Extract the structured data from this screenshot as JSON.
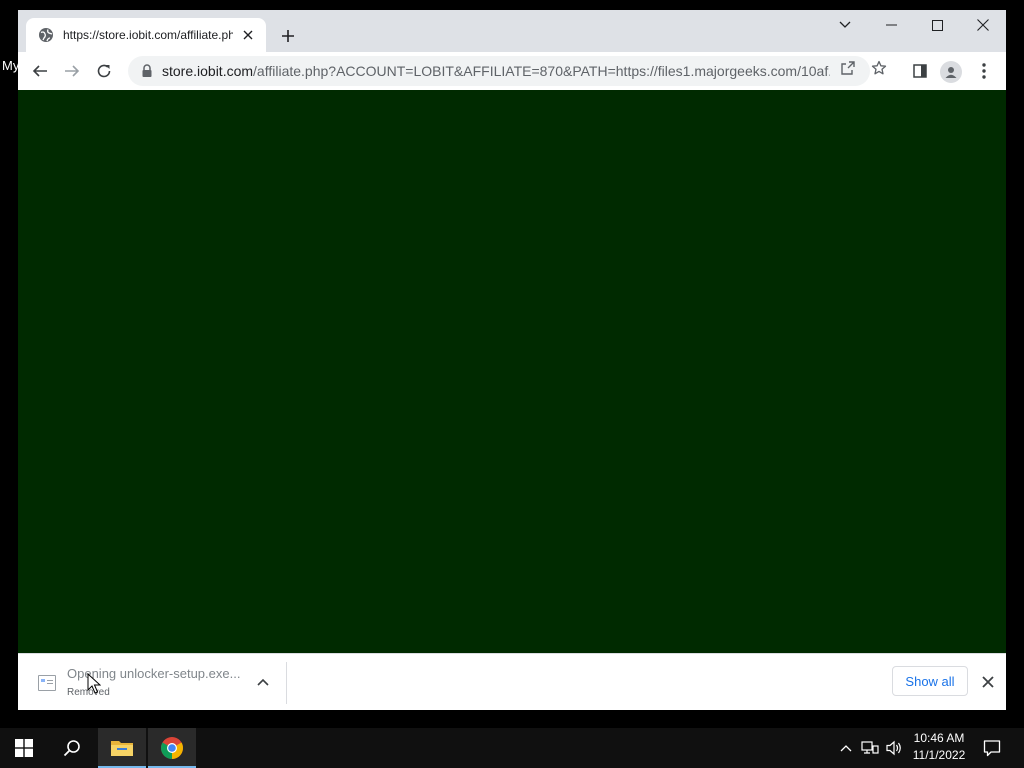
{
  "desktop": {
    "label": "My"
  },
  "browser": {
    "tab": {
      "title": "https://store.iobit.com/affiliate.php"
    },
    "url": {
      "host": "store.iobit.com",
      "path": "/affiliate.php?ACCOUNT=LOBIT&AFFILIATE=870&PATH=https://files1.majorgeeks.com/10af..."
    }
  },
  "page": {
    "background_color": "#002a00"
  },
  "download_shelf": {
    "item": {
      "name": "Opening unlocker-setup.exe...",
      "status": "Removed"
    },
    "show_all_label": "Show all"
  },
  "taskbar": {
    "time": "10:46 AM",
    "date": "11/1/2022"
  }
}
